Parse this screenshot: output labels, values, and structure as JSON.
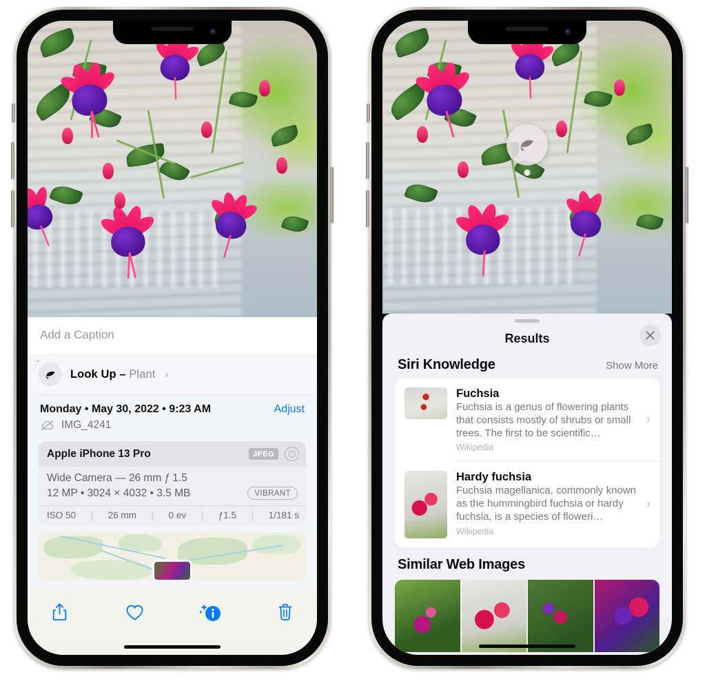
{
  "left_phone": {
    "photo_alt": "fuchsia-flowers-photo",
    "caption": {
      "placeholder": "Add a Caption",
      "value": ""
    },
    "lookup": {
      "icon": "leaf-icon",
      "sparkle_icon": "sparkle-icon",
      "label": "Look Up – ",
      "subject": "Plant",
      "chevron": "›"
    },
    "meta": {
      "date": "Monday • May 30, 2022 • 9:23 AM",
      "adjust_label": "Adjust",
      "cloud_icon": "cloud-slash-icon",
      "filename": "IMG_4241"
    },
    "camera": {
      "device": "Apple iPhone 13 Pro",
      "format_badge": "JPEG",
      "hdr_icon": "hdr-circle-icon",
      "lens_line": "Wide Camera — 26 mm ƒ 1.5",
      "size_line": "12 MP • 3024 × 4032 • 3.5 MB",
      "style_badge": "VIBRANT",
      "exif": [
        "ISO 50",
        "26 mm",
        "0 ev",
        "ƒ1.5",
        "1/181 s"
      ]
    },
    "map": {
      "name": "location-map-preview"
    },
    "toolbar": {
      "share_label": "share-icon",
      "favorite_label": "heart-icon",
      "info_label": "info-sparkle-icon",
      "delete_label": "trash-icon"
    }
  },
  "right_phone": {
    "badge": {
      "icon": "leaf-icon"
    },
    "sheet": {
      "title": "Results",
      "close_icon": "close-icon",
      "grabber": "drag-handle"
    },
    "siri_knowledge": {
      "heading": "Siri Knowledge",
      "show_more": "Show More",
      "items": [
        {
          "title": "Fuchsia",
          "description": "Fuchsia is a genus of flowering plants that consists mostly of shrubs or small trees. The first to be scientific…",
          "source": "Wikipedia",
          "chevron": "›"
        },
        {
          "title": "Hardy fuchsia",
          "description": "Fuchsia magellanica, commonly known as the hummingbird fuchsia or hardy fuchsia, is a species of floweri…",
          "source": "Wikipedia",
          "chevron": "›"
        }
      ]
    },
    "similar_web_images": {
      "heading": "Similar Web Images",
      "thumbs": [
        "web-image-1",
        "web-image-2",
        "web-image-3",
        "web-image-4"
      ]
    }
  },
  "colors": {
    "accent_blue": "#057AFF",
    "sheet_bg": "#F1F1F5",
    "card_bg": "#FFFFFF",
    "secondary_text": "#7A7A80"
  }
}
